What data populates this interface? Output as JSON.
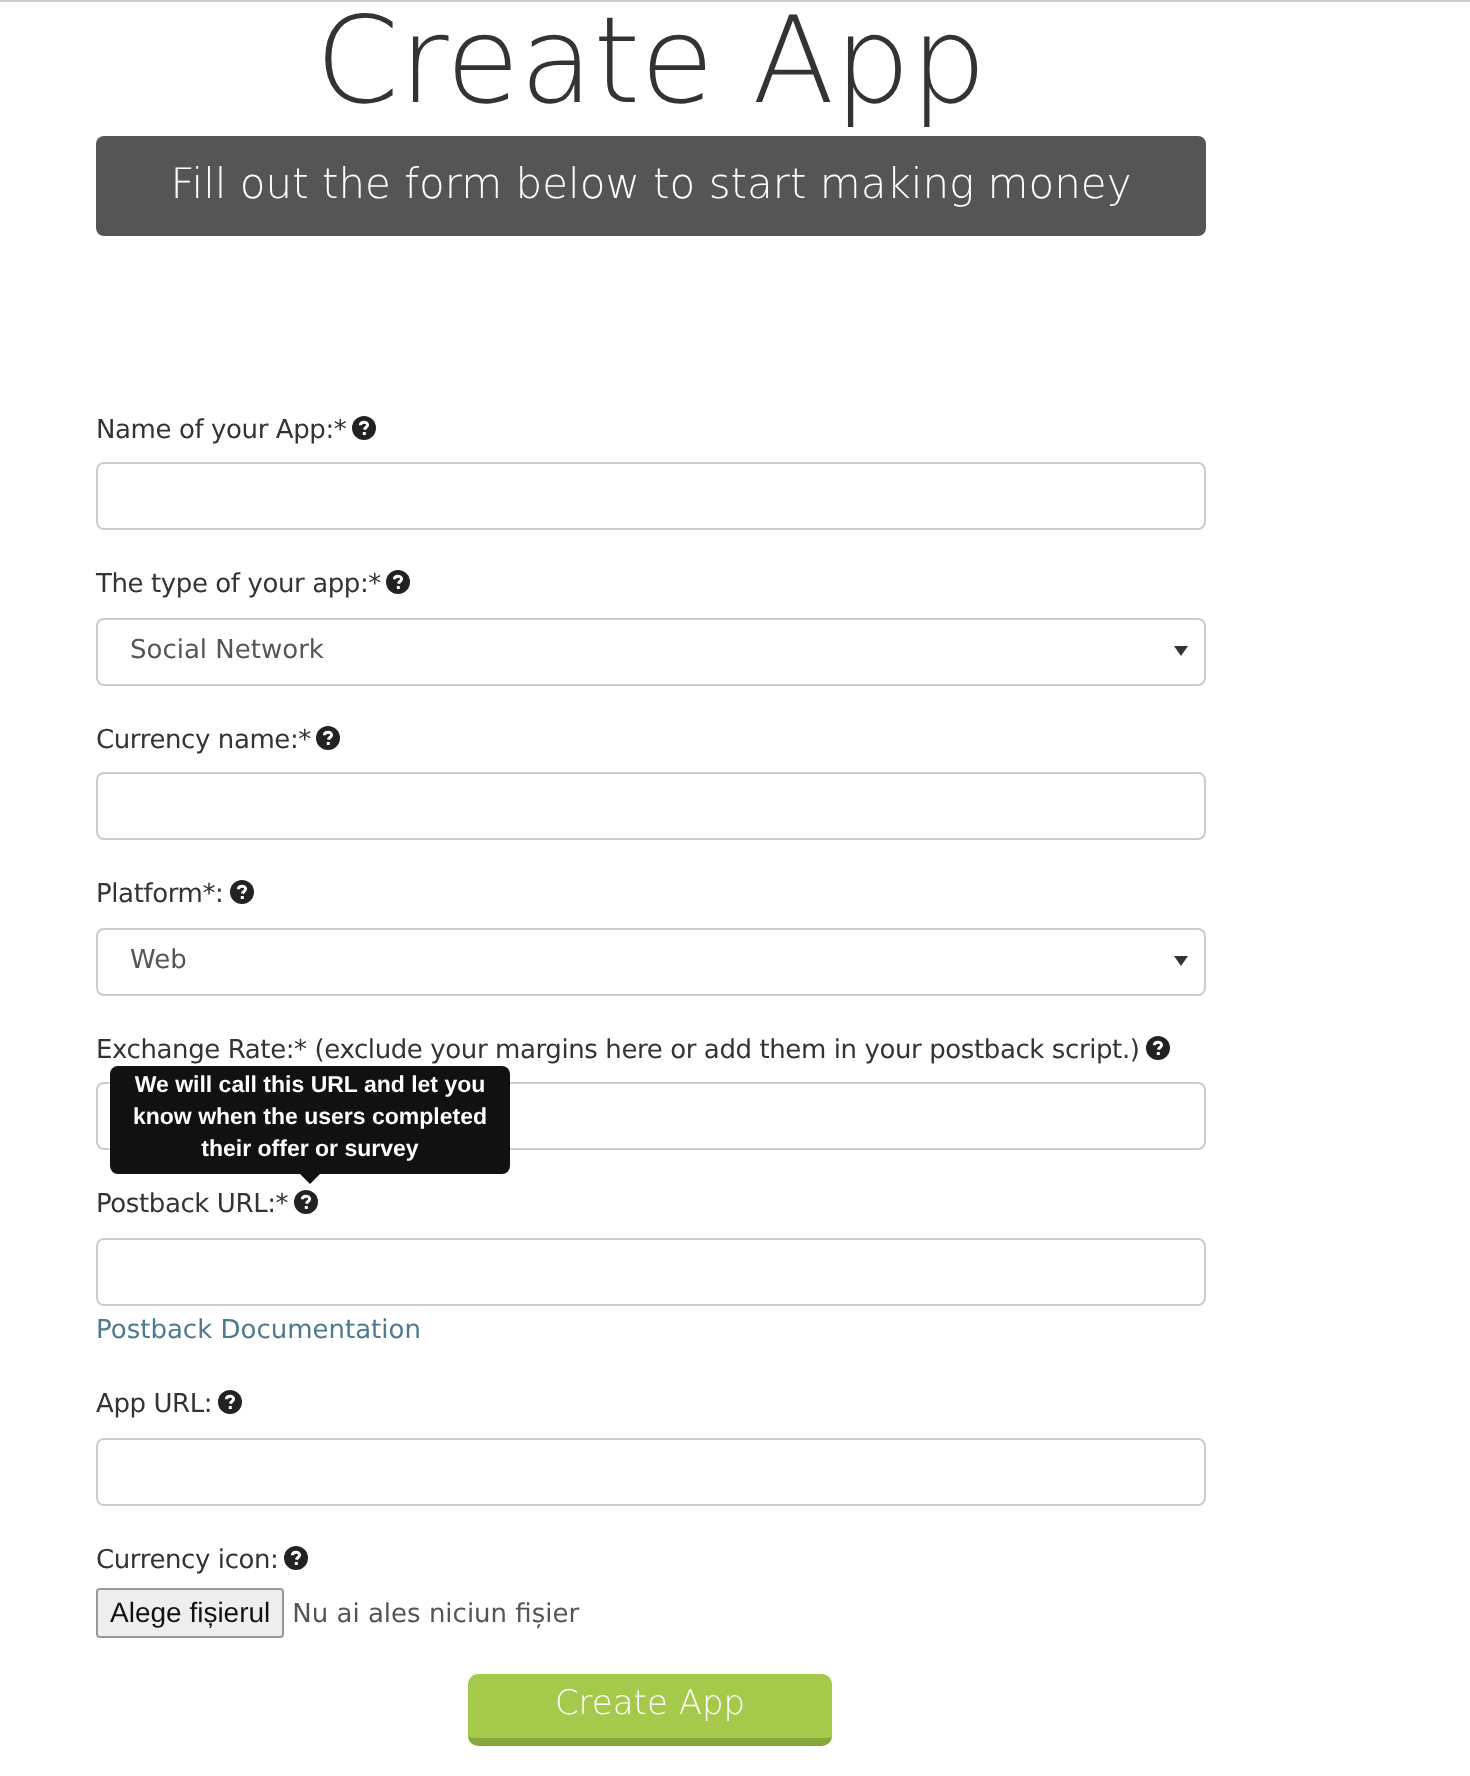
{
  "title": "Create App",
  "banner": "Fill out the form below to start making money",
  "fields": [
    {
      "kind": "text",
      "label": "Name of your App:*"
    },
    {
      "kind": "select",
      "label": "The type of your app:*",
      "value": "Social Network"
    },
    {
      "kind": "text",
      "label": "Currency name:*"
    },
    {
      "kind": "select",
      "label": "Platform*:",
      "value": "Web"
    },
    {
      "kind": "text",
      "label": "Exchange Rate:* (exclude your margins here or add them in your postback script.)"
    },
    {
      "kind": "text",
      "label": "Postback URL:*",
      "tooltip": "We will call this URL and let you know when the users completed their offer or survey",
      "link": "Postback Documentation"
    },
    {
      "kind": "text",
      "label": "App URL:"
    },
    {
      "kind": "file",
      "label": "Currency icon:",
      "button": "Alege fișierul",
      "status": "Nu ai ales niciun fișier"
    }
  ],
  "submit": "Create App"
}
